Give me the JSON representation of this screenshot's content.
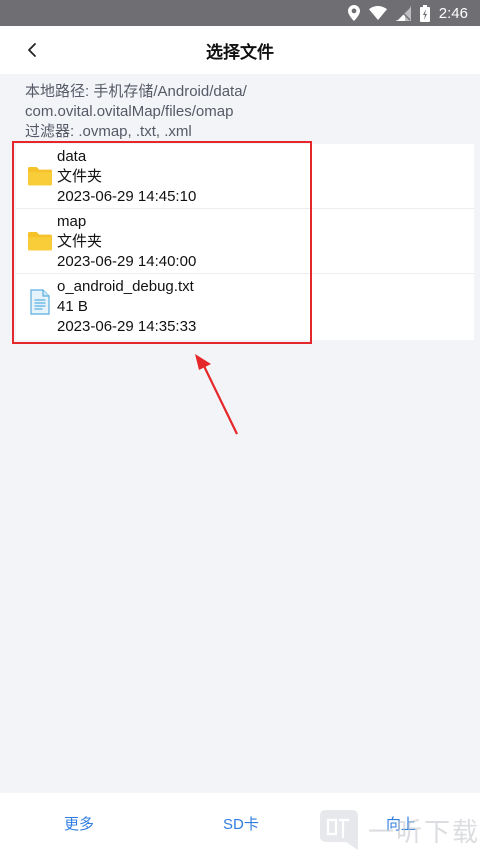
{
  "status_bar": {
    "time": "2:46"
  },
  "header": {
    "title": "选择文件",
    "back_icon": "chevron-left-icon"
  },
  "path": {
    "line1": "本地路径: 手机存储/Android/data/",
    "line2": "com.ovital.ovitalMap/files/omap",
    "filter": "过滤器: .ovmap, .txt, .xml"
  },
  "files": [
    {
      "name": "data",
      "meta": "文件夹",
      "date": "2023-06-29 14:45:10",
      "icon": "folder-icon"
    },
    {
      "name": "map",
      "meta": "文件夹",
      "date": "2023-06-29 14:40:00",
      "icon": "folder-icon"
    },
    {
      "name": "o_android_debug.txt",
      "meta": "41 B",
      "date": "2023-06-29 14:35:33",
      "icon": "text-file-icon"
    }
  ],
  "bottom": {
    "more": "更多",
    "sd": "SD卡",
    "up": "向上"
  },
  "watermark": {
    "text": "一听下载"
  },
  "colors": {
    "accent": "#2f7de1",
    "folder": "#f6c22a",
    "highlight": "#e5262a"
  }
}
